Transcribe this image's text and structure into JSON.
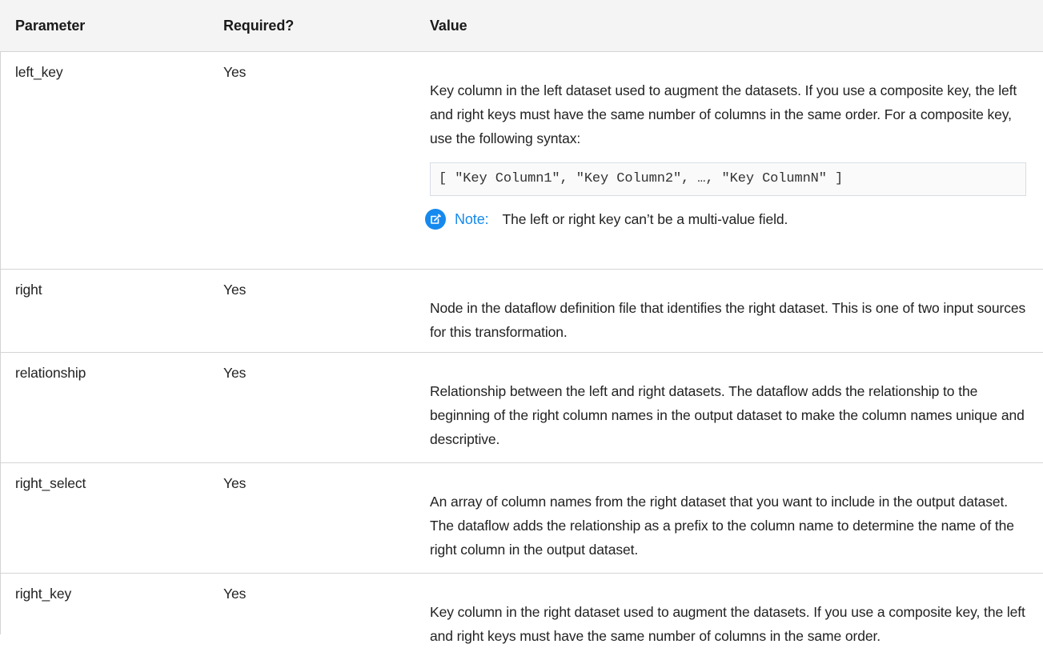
{
  "table": {
    "headers": {
      "parameter": "Parameter",
      "required": "Required?",
      "value": "Value"
    },
    "rows": [
      {
        "parameter": "left_key",
        "required": "Yes",
        "value": "Key column in the left dataset used to augment the datasets. If you use a composite key, the left and right keys must have the same number of columns in the same order. For a composite key, use the following syntax:",
        "code": "[ \"Key Column1\", \"Key Column2\", …, \"Key ColumnN\" ]",
        "note_label": "Note:",
        "note_text": "The left or right key can’t be a multi-value field.",
        "note_icon": "edit-note-icon"
      },
      {
        "parameter": "right",
        "required": "Yes",
        "value": "Node in the dataflow definition file that identifies the right dataset. This is one of two input sources for this transformation."
      },
      {
        "parameter": "relationship",
        "required": "Yes",
        "value": "Relationship between the left and right datasets. The dataflow adds the relationship to the beginning of the right column names in the output dataset to make the column names unique and descriptive."
      },
      {
        "parameter": "right_select",
        "required": "Yes",
        "value": "An array of column names from the right dataset that you want to include in the output dataset. The dataflow adds the relationship as a prefix to the column name to determine the name of the right column in the output dataset."
      },
      {
        "parameter": "right_key",
        "required": "Yes",
        "value": "Key column in the right dataset used to augment the datasets. If you use a composite key, the left and right keys must have the same number of columns in the same order."
      }
    ]
  },
  "colors": {
    "header_bg": "#f4f4f4",
    "note_accent": "#1589ee",
    "border": "#d4d4d4"
  }
}
